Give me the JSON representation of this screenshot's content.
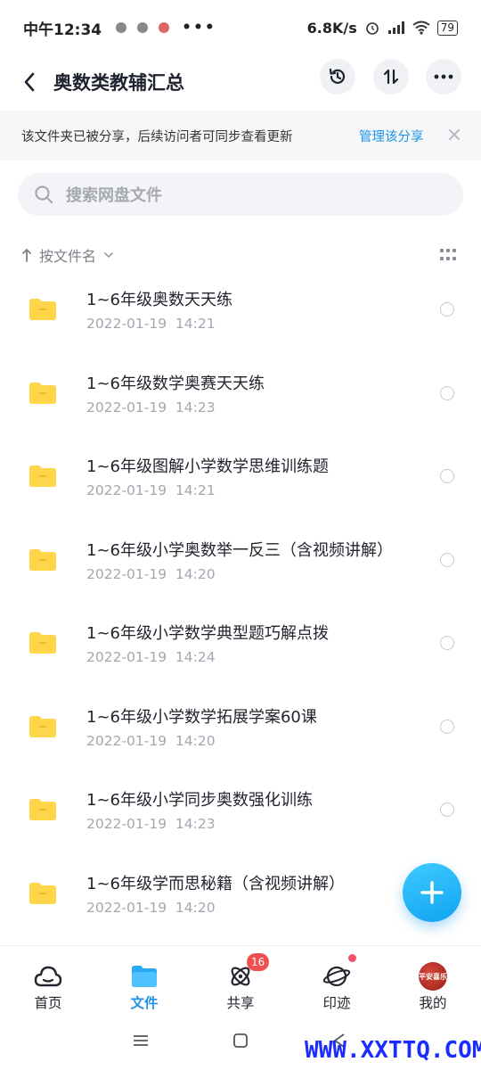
{
  "status_bar": {
    "time": "中午12:34",
    "more": "•••",
    "speed": "6.8K/s",
    "battery": "79"
  },
  "header": {
    "title": "奥数类教辅汇总"
  },
  "banner": {
    "text": "该文件夹已被分享，后续访问者可同步查看更新",
    "link": "管理该分享"
  },
  "search": {
    "placeholder": "搜索网盘文件"
  },
  "sort": {
    "label": "按文件名"
  },
  "files": [
    {
      "name": "1~6年级奥数天天练",
      "date": "2022-01-19  14:21"
    },
    {
      "name": "1~6年级数学奥赛天天练",
      "date": "2022-01-19  14:23"
    },
    {
      "name": "1~6年级图解小学数学思维训练题",
      "date": "2022-01-19  14:21"
    },
    {
      "name": "1~6年级小学奥数举一反三（含视频讲解）",
      "date": "2022-01-19  14:20"
    },
    {
      "name": "1~6年级小学数学典型题巧解点拨",
      "date": "2022-01-19  14:24"
    },
    {
      "name": "1~6年级小学数学拓展学案60课",
      "date": "2022-01-19  14:20"
    },
    {
      "name": "1~6年级小学同步奥数强化训练",
      "date": "2022-01-19  14:23"
    },
    {
      "name": "1~6年级学而思秘籍（含视频讲解）",
      "date": "2022-01-19  14:20"
    }
  ],
  "bottom_nav": {
    "tabs": [
      {
        "label": "首页"
      },
      {
        "label": "文件"
      },
      {
        "label": "共享",
        "badge": "16"
      },
      {
        "label": "印迹"
      },
      {
        "label": "我的"
      }
    ]
  },
  "avatar_text": "平安喜乐",
  "watermark": "WWW.XXTTQ.COM",
  "colors": {
    "accent": "#1f93e8",
    "folder": "#ffd54a",
    "badge": "#f14f4f"
  }
}
